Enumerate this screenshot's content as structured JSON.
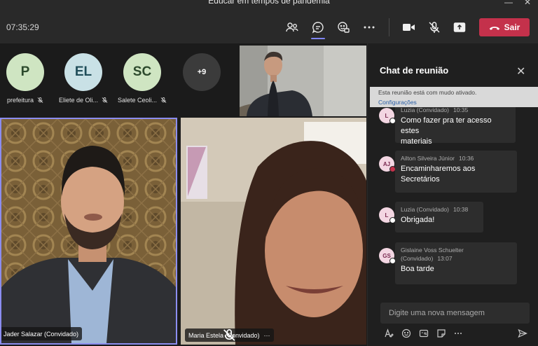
{
  "window": {
    "title": "Educar em tempos de pandemia"
  },
  "toolbar": {
    "clock": "07:35:29",
    "leave_label": "Sair",
    "icons": [
      "people-icon",
      "chat-icon",
      "reactions-icon",
      "more-icon",
      "camera-icon",
      "mic-off-icon",
      "share-icon",
      "phone-icon"
    ],
    "leave_color": "#c4314b",
    "active_underline_color": "#7f85f5"
  },
  "participants": [
    {
      "initials": "P",
      "name": "prefeitura",
      "color": "#cfe5c2"
    },
    {
      "initials": "EL",
      "name": "Eliete de Oli...",
      "color": "#c9e1e6"
    },
    {
      "initials": "SC",
      "name": "Salete Ceoli...",
      "color": "#cfe5c2"
    }
  ],
  "overflow_count": "+9",
  "videos": [
    {
      "name": "Jader Salazar (Convidado)",
      "highlight_color": "#8b8df0"
    },
    {
      "name": "Maria Estela (Convidado)",
      "more": "···"
    }
  ],
  "chat": {
    "title": "Chat de reunião",
    "close": "✕",
    "banner_text": "Esta reunião está com mudo ativado.",
    "banner_link": "Configurações",
    "messages": [
      {
        "initials": "L",
        "author": "Luzia (Convidado)",
        "time": "10:35",
        "line1": "Como fazer pra ter acesso estes",
        "line2": "materiais",
        "status": "available"
      },
      {
        "initials": "AJ",
        "author": "Ailton Silveira Júnior",
        "time": "10:36",
        "line1": "Encaminharemos aos",
        "line2": "Secretários",
        "status": "busy"
      },
      {
        "initials": "L",
        "author": "Luzia (Convidado)",
        "time": "10:38",
        "line1": "Obrigada!",
        "line2": "",
        "status": "available"
      },
      {
        "initials": "GS",
        "author": "Gislaine Voss Schuelter",
        "author2": "(Convidado)",
        "time": "13:07",
        "line1": "Boa tarde",
        "line2": "",
        "status": "available"
      }
    ],
    "compose_placeholder": "Digite uma nova mensagem",
    "compose_tools": [
      "format-icon",
      "emoji-icon",
      "gif-icon",
      "sticker-icon",
      "more-icon",
      "send-icon"
    ]
  }
}
